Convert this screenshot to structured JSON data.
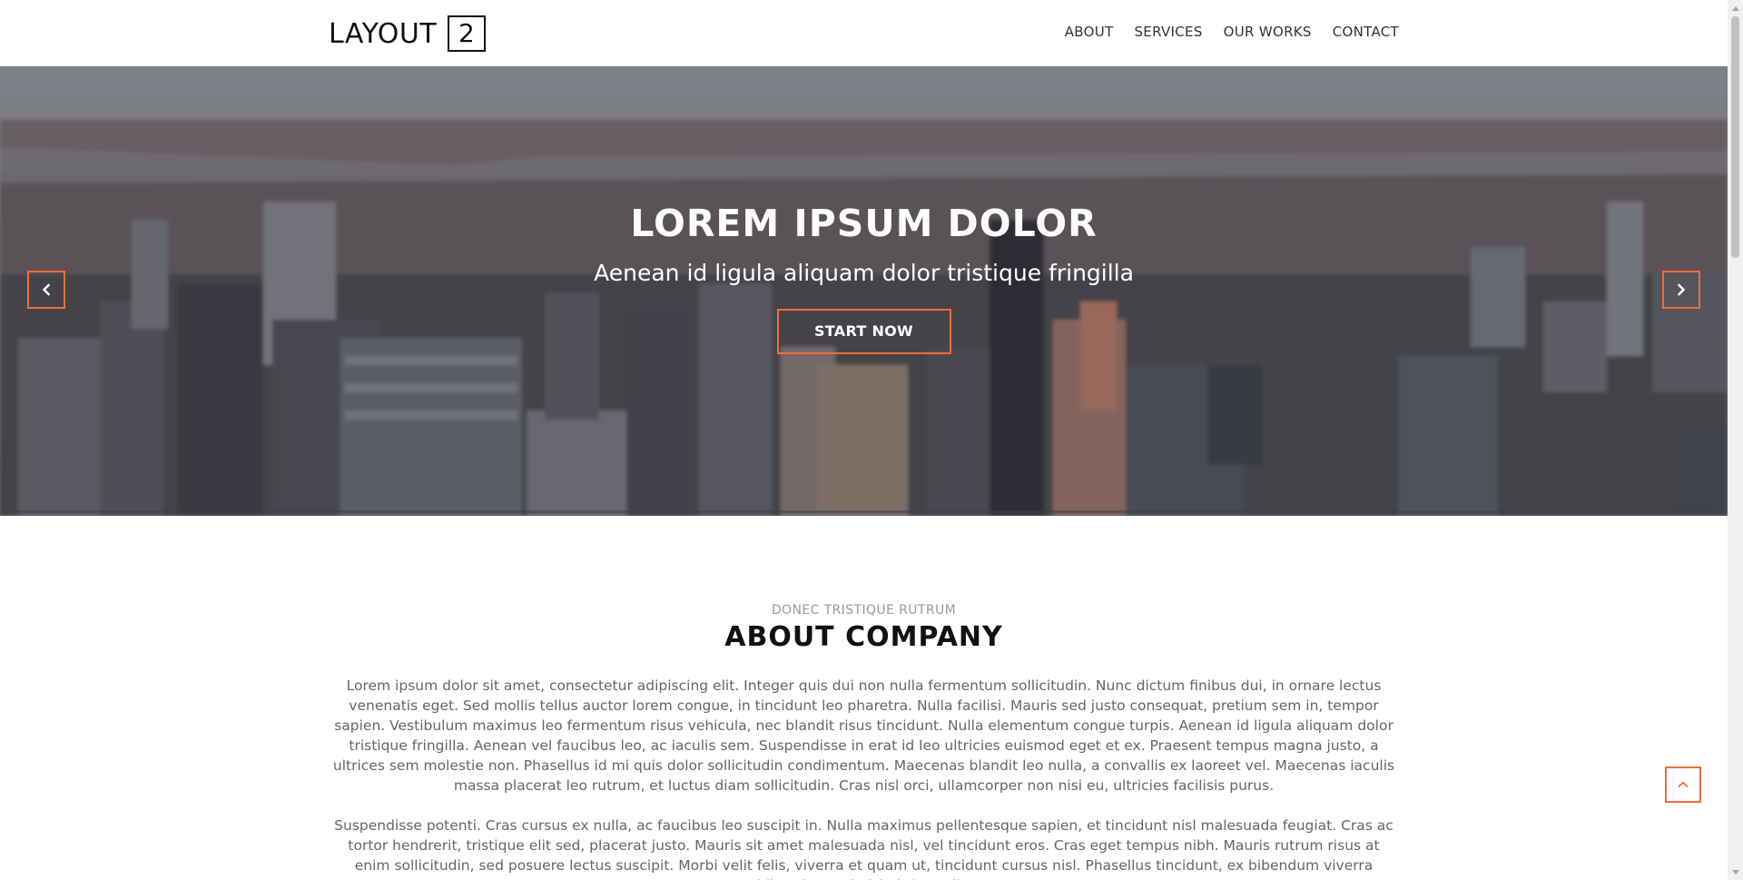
{
  "header": {
    "brand_text": "LAYOUT",
    "brand_number": "2",
    "nav": [
      {
        "label": "ABOUT"
      },
      {
        "label": "SERVICES"
      },
      {
        "label": "OUR WORKS"
      },
      {
        "label": "CONTACT"
      }
    ]
  },
  "hero": {
    "title": "LOREM IPSUM DOLOR",
    "subtitle": "Aenean id ligula aliquam dolor tristique fringilla",
    "cta_label": "START NOW",
    "prev_icon": "chevron-left-icon",
    "next_icon": "chevron-right-icon"
  },
  "about": {
    "kicker": "DONEC TRISTIQUE RUTRUM",
    "title": "ABOUT COMPANY",
    "paragraph_1": "Lorem ipsum dolor sit amet, consectetur adipiscing elit. Integer quis dui non nulla fermentum sollicitudin. Nunc dictum finibus dui, in ornare lectus venenatis eget. Sed mollis tellus auctor lorem congue, in tincidunt leo pharetra. Nulla facilisi. Mauris sed justo consequat, pretium sem in, tempor sapien. Vestibulum maximus leo fermentum risus vehicula, nec blandit risus tincidunt. Nulla elementum congue turpis. Aenean id ligula aliquam dolor tristique fringilla. Aenean vel faucibus leo, ac iaculis sem. Suspendisse in erat id leo ultricies euismod eget et ex. Praesent tempus magna justo, a ultrices sem molestie non. Phasellus id mi quis dolor sollicitudin condimentum. Maecenas blandit leo nulla, a convallis ex laoreet vel. Maecenas iaculis massa placerat leo rutrum, et luctus diam sollicitudin. Cras nisl orci, ullamcorper non nisi eu, ultricies facilisis purus.",
    "paragraph_2": "Suspendisse potenti. Cras cursus ex nulla, ac faucibus leo suscipit in. Nulla maximus pellentesque sapien, et tincidunt nisl malesuada feugiat. Cras ac tortor hendrerit, tristique elit sed, placerat justo. Mauris sit amet malesuada nisl, vel tincidunt eros. Cras eget tempus nibh. Mauris rutrum risus at enim sollicitudin, sed posuere lectus suscipit. Morbi velit felis, viverra et quam ut, tincidunt cursus nisl. Phasellus tincidunt, ex bibendum viverra bibendum, mi nisi ultrices elit,"
  },
  "floating": {
    "to_top_icon": "chevron-up-icon"
  },
  "colors": {
    "accent": "#f06d3c",
    "text_dark": "#111111",
    "text_body": "#666666",
    "kicker": "#9a9a9a"
  }
}
